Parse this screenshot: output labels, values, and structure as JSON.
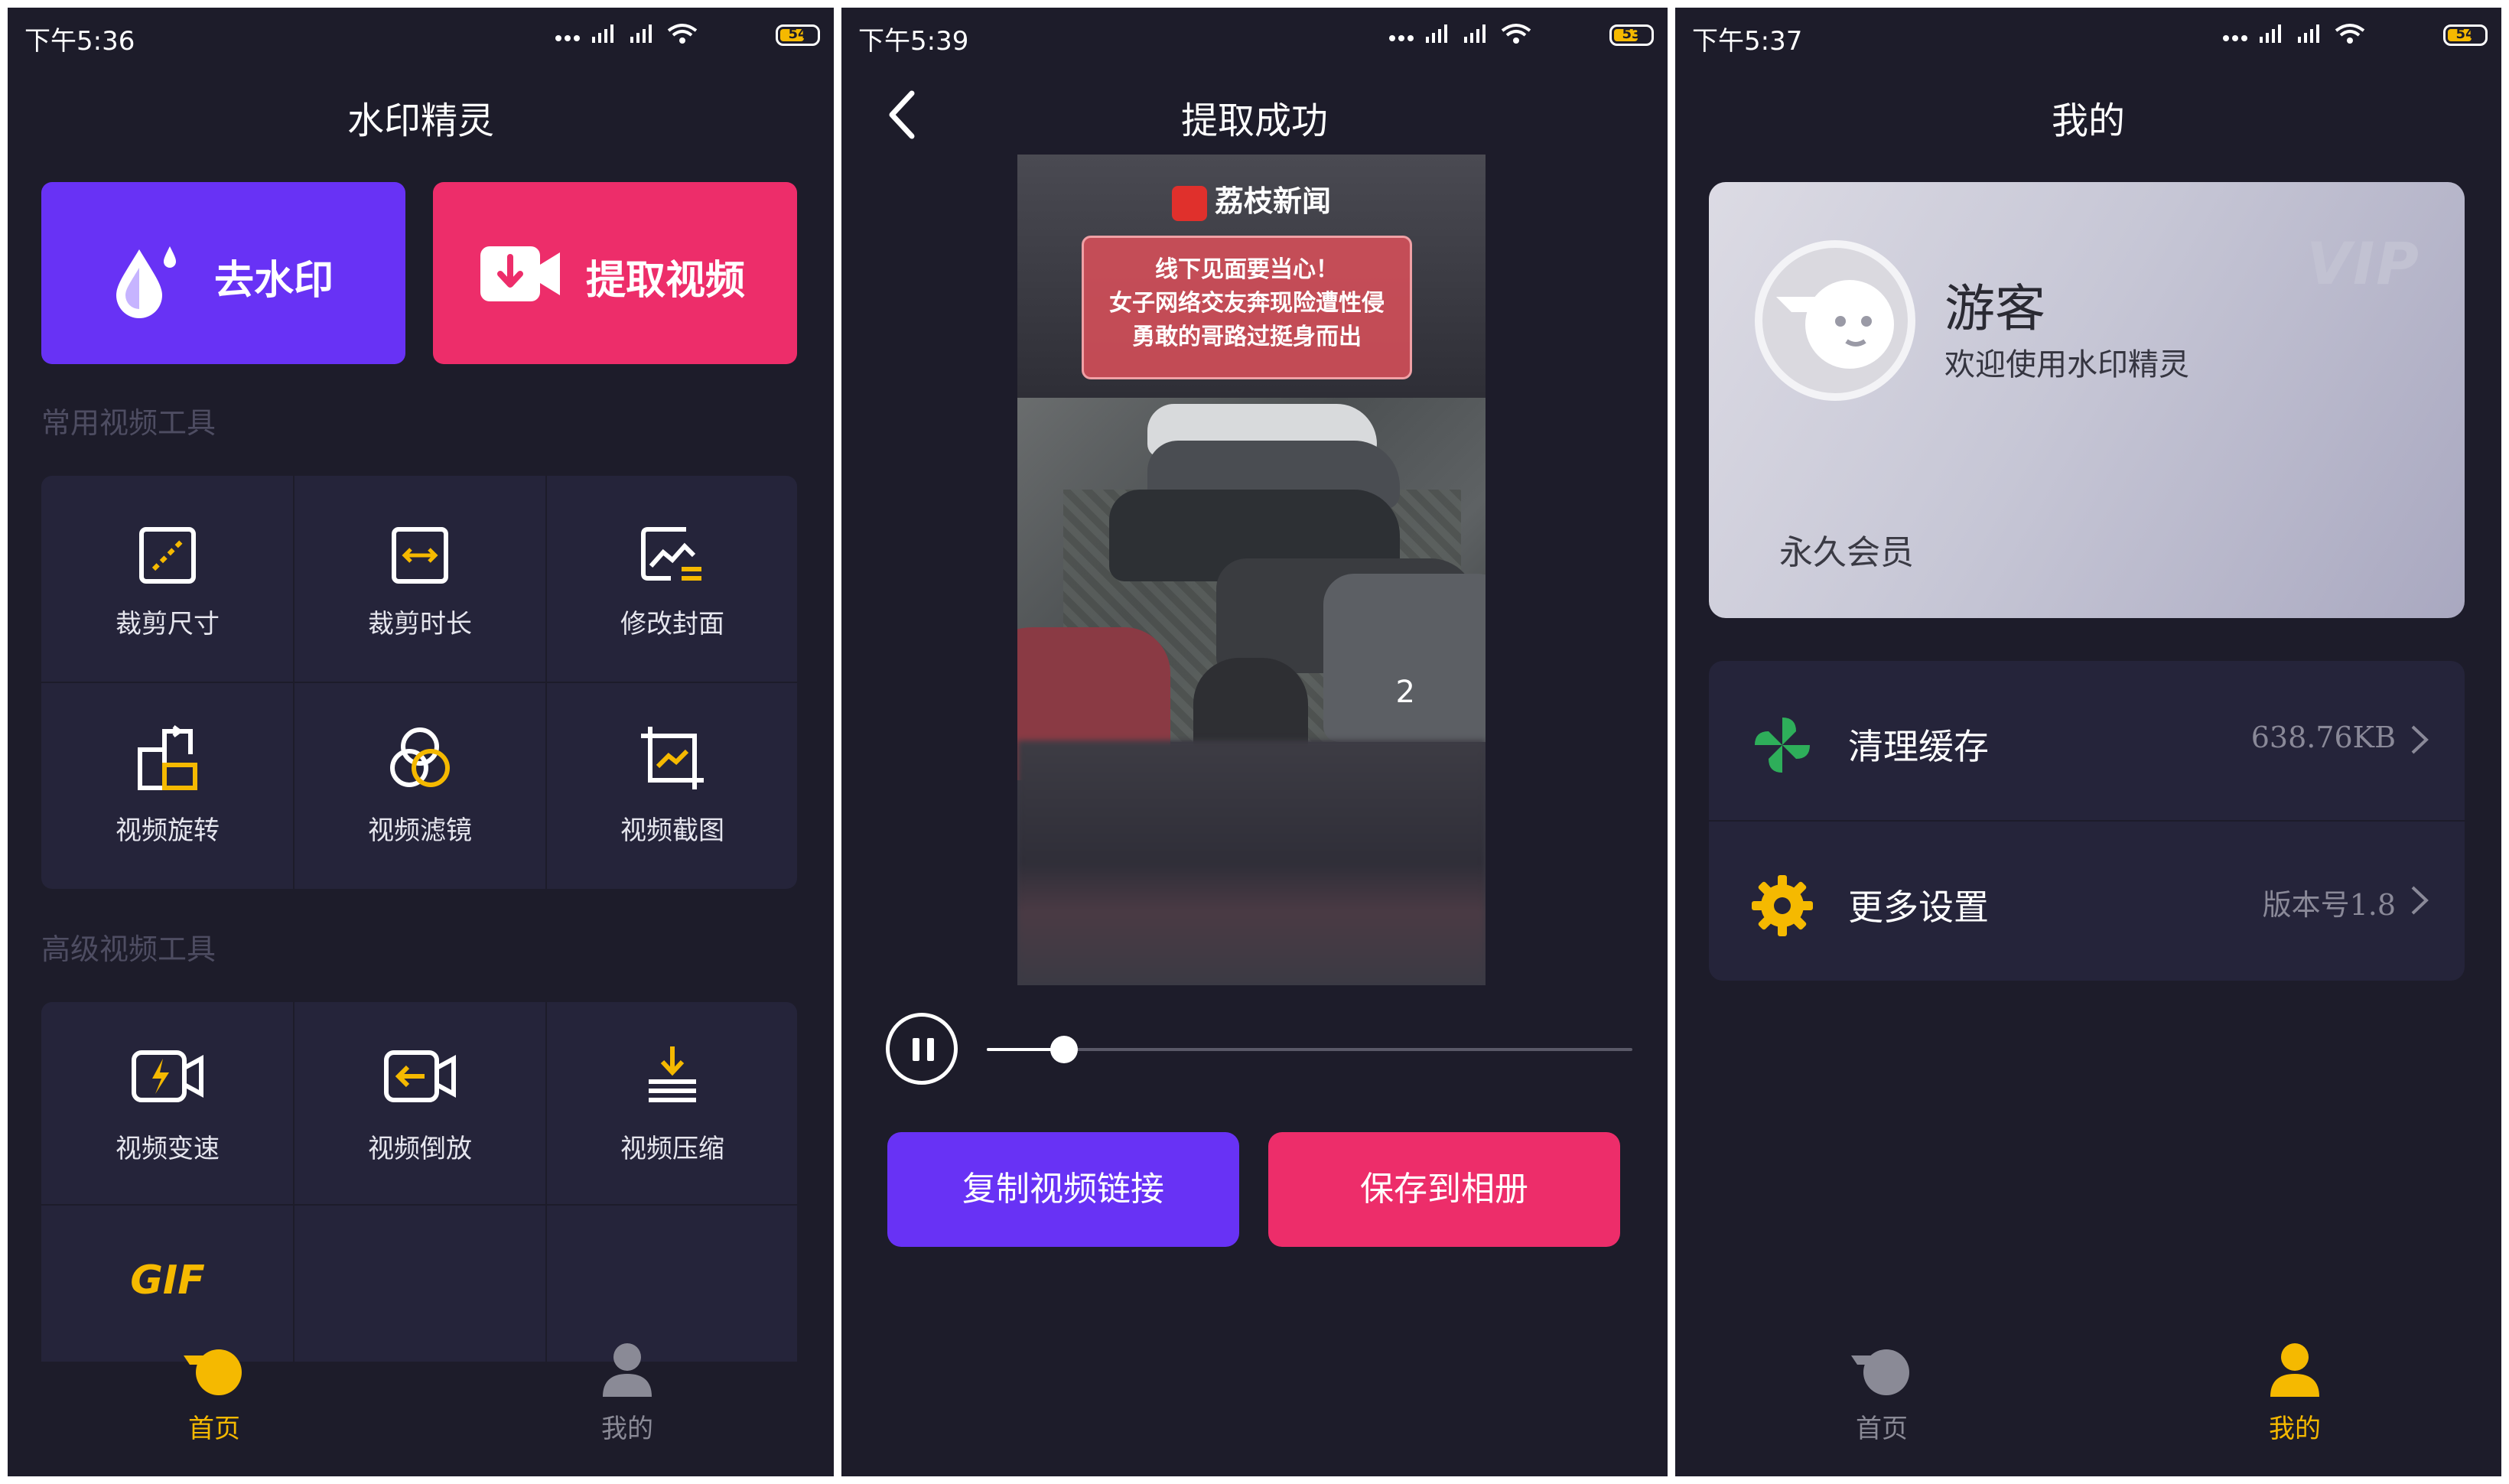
{
  "colors": {
    "background": "#1d1c2a",
    "card": "#25243a",
    "purple": "#6832f5",
    "pink": "#ed2d6a",
    "accent_yellow": "#f5b900",
    "tab_inactive": "#8a8a96"
  },
  "panel1": {
    "status": {
      "time": "下午5:36",
      "battery": "54"
    },
    "title": "水印精灵",
    "remove_watermark_label": "去水印",
    "extract_video_label": "提取视频",
    "section_common": "常用视频工具",
    "common_tools": [
      {
        "label": "裁剪尺寸",
        "icon": "crop-size-icon"
      },
      {
        "label": "裁剪时长",
        "icon": "trim-duration-icon"
      },
      {
        "label": "修改封面",
        "icon": "edit-cover-icon"
      },
      {
        "label": "视频旋转",
        "icon": "rotate-icon"
      },
      {
        "label": "视频滤镜",
        "icon": "filter-icon"
      },
      {
        "label": "视频截图",
        "icon": "screenshot-icon"
      }
    ],
    "section_advanced": "高级视频工具",
    "advanced_tools": [
      {
        "label": "视频变速",
        "icon": "speed-icon"
      },
      {
        "label": "视频倒放",
        "icon": "reverse-icon"
      },
      {
        "label": "视频压缩",
        "icon": "compress-icon"
      },
      {
        "label": "GIF",
        "icon": "gif-icon"
      }
    ],
    "tabs": [
      {
        "label": "首页",
        "active": true
      },
      {
        "label": "我的",
        "active": false
      }
    ]
  },
  "panel2": {
    "status": {
      "time": "下午5:39",
      "battery": "53"
    },
    "title": "提取成功",
    "video": {
      "brand": "荔枝新闻",
      "headline_lines": [
        "线下见面要当心！",
        "女子网络交友奔现险遭性侵",
        "勇敢的哥路过挺身而出"
      ],
      "counter": "2"
    },
    "progress": 0.12,
    "copy_link_label": "复制视频链接",
    "save_album_label": "保存到相册"
  },
  "panel3": {
    "status": {
      "time": "下午5:37",
      "battery": "54"
    },
    "title": "我的",
    "profile": {
      "name": "游客",
      "welcome": "欢迎使用水印精灵",
      "vip_badge": "VIP",
      "membership": "永久会员"
    },
    "settings": [
      {
        "label": "清理缓存",
        "value": "638.76KB",
        "icon": "pinwheel-icon"
      },
      {
        "label": "更多设置",
        "value": "版本号1.8",
        "icon": "gear-icon"
      }
    ],
    "tabs": [
      {
        "label": "首页",
        "active": false
      },
      {
        "label": "我的",
        "active": true
      }
    ]
  }
}
